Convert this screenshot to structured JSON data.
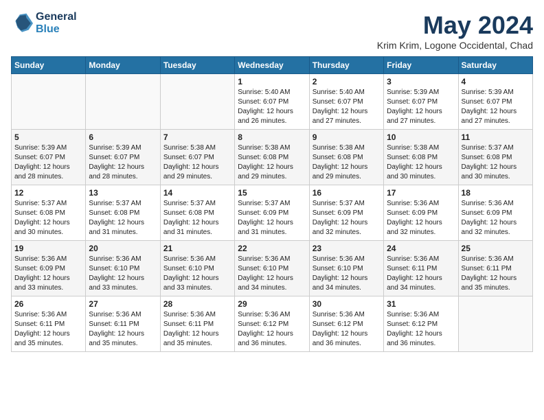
{
  "logo": {
    "line1": "General",
    "line2": "Blue"
  },
  "title": "May 2024",
  "subtitle": "Krim Krim, Logone Occidental, Chad",
  "days_of_week": [
    "Sunday",
    "Monday",
    "Tuesday",
    "Wednesday",
    "Thursday",
    "Friday",
    "Saturday"
  ],
  "weeks": [
    [
      {
        "day": "",
        "info": ""
      },
      {
        "day": "",
        "info": ""
      },
      {
        "day": "",
        "info": ""
      },
      {
        "day": "1",
        "info": "Sunrise: 5:40 AM\nSunset: 6:07 PM\nDaylight: 12 hours\nand 26 minutes."
      },
      {
        "day": "2",
        "info": "Sunrise: 5:40 AM\nSunset: 6:07 PM\nDaylight: 12 hours\nand 27 minutes."
      },
      {
        "day": "3",
        "info": "Sunrise: 5:39 AM\nSunset: 6:07 PM\nDaylight: 12 hours\nand 27 minutes."
      },
      {
        "day": "4",
        "info": "Sunrise: 5:39 AM\nSunset: 6:07 PM\nDaylight: 12 hours\nand 27 minutes."
      }
    ],
    [
      {
        "day": "5",
        "info": "Sunrise: 5:39 AM\nSunset: 6:07 PM\nDaylight: 12 hours\nand 28 minutes."
      },
      {
        "day": "6",
        "info": "Sunrise: 5:39 AM\nSunset: 6:07 PM\nDaylight: 12 hours\nand 28 minutes."
      },
      {
        "day": "7",
        "info": "Sunrise: 5:38 AM\nSunset: 6:07 PM\nDaylight: 12 hours\nand 29 minutes."
      },
      {
        "day": "8",
        "info": "Sunrise: 5:38 AM\nSunset: 6:08 PM\nDaylight: 12 hours\nand 29 minutes."
      },
      {
        "day": "9",
        "info": "Sunrise: 5:38 AM\nSunset: 6:08 PM\nDaylight: 12 hours\nand 29 minutes."
      },
      {
        "day": "10",
        "info": "Sunrise: 5:38 AM\nSunset: 6:08 PM\nDaylight: 12 hours\nand 30 minutes."
      },
      {
        "day": "11",
        "info": "Sunrise: 5:37 AM\nSunset: 6:08 PM\nDaylight: 12 hours\nand 30 minutes."
      }
    ],
    [
      {
        "day": "12",
        "info": "Sunrise: 5:37 AM\nSunset: 6:08 PM\nDaylight: 12 hours\nand 30 minutes."
      },
      {
        "day": "13",
        "info": "Sunrise: 5:37 AM\nSunset: 6:08 PM\nDaylight: 12 hours\nand 31 minutes."
      },
      {
        "day": "14",
        "info": "Sunrise: 5:37 AM\nSunset: 6:08 PM\nDaylight: 12 hours\nand 31 minutes."
      },
      {
        "day": "15",
        "info": "Sunrise: 5:37 AM\nSunset: 6:09 PM\nDaylight: 12 hours\nand 31 minutes."
      },
      {
        "day": "16",
        "info": "Sunrise: 5:37 AM\nSunset: 6:09 PM\nDaylight: 12 hours\nand 32 minutes."
      },
      {
        "day": "17",
        "info": "Sunrise: 5:36 AM\nSunset: 6:09 PM\nDaylight: 12 hours\nand 32 minutes."
      },
      {
        "day": "18",
        "info": "Sunrise: 5:36 AM\nSunset: 6:09 PM\nDaylight: 12 hours\nand 32 minutes."
      }
    ],
    [
      {
        "day": "19",
        "info": "Sunrise: 5:36 AM\nSunset: 6:09 PM\nDaylight: 12 hours\nand 33 minutes."
      },
      {
        "day": "20",
        "info": "Sunrise: 5:36 AM\nSunset: 6:10 PM\nDaylight: 12 hours\nand 33 minutes."
      },
      {
        "day": "21",
        "info": "Sunrise: 5:36 AM\nSunset: 6:10 PM\nDaylight: 12 hours\nand 33 minutes."
      },
      {
        "day": "22",
        "info": "Sunrise: 5:36 AM\nSunset: 6:10 PM\nDaylight: 12 hours\nand 34 minutes."
      },
      {
        "day": "23",
        "info": "Sunrise: 5:36 AM\nSunset: 6:10 PM\nDaylight: 12 hours\nand 34 minutes."
      },
      {
        "day": "24",
        "info": "Sunrise: 5:36 AM\nSunset: 6:11 PM\nDaylight: 12 hours\nand 34 minutes."
      },
      {
        "day": "25",
        "info": "Sunrise: 5:36 AM\nSunset: 6:11 PM\nDaylight: 12 hours\nand 35 minutes."
      }
    ],
    [
      {
        "day": "26",
        "info": "Sunrise: 5:36 AM\nSunset: 6:11 PM\nDaylight: 12 hours\nand 35 minutes."
      },
      {
        "day": "27",
        "info": "Sunrise: 5:36 AM\nSunset: 6:11 PM\nDaylight: 12 hours\nand 35 minutes."
      },
      {
        "day": "28",
        "info": "Sunrise: 5:36 AM\nSunset: 6:11 PM\nDaylight: 12 hours\nand 35 minutes."
      },
      {
        "day": "29",
        "info": "Sunrise: 5:36 AM\nSunset: 6:12 PM\nDaylight: 12 hours\nand 36 minutes."
      },
      {
        "day": "30",
        "info": "Sunrise: 5:36 AM\nSunset: 6:12 PM\nDaylight: 12 hours\nand 36 minutes."
      },
      {
        "day": "31",
        "info": "Sunrise: 5:36 AM\nSunset: 6:12 PM\nDaylight: 12 hours\nand 36 minutes."
      },
      {
        "day": "",
        "info": ""
      }
    ]
  ]
}
